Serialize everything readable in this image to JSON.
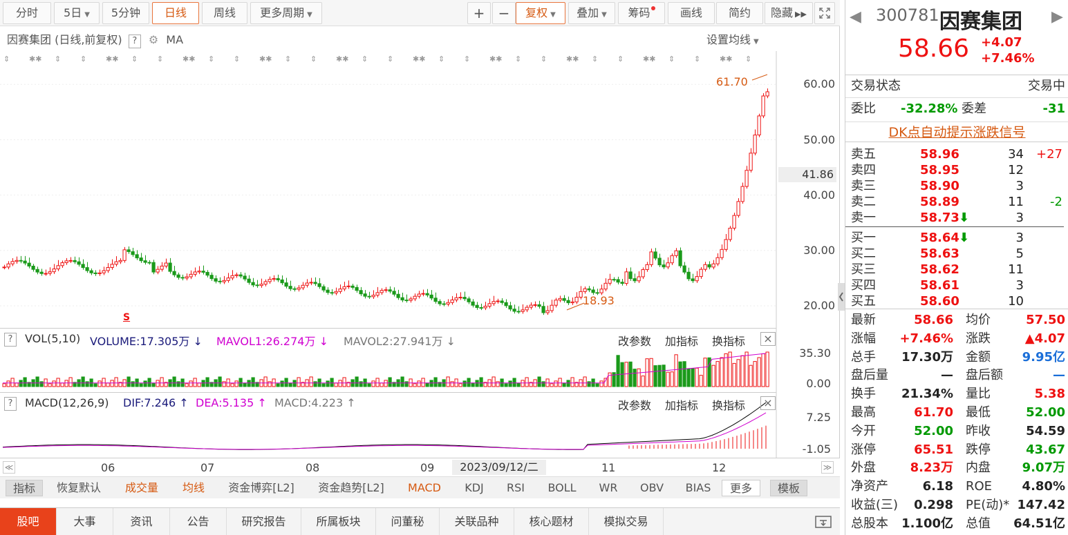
{
  "toolbar": {
    "periods": [
      "分时",
      "5日",
      "5分钟",
      "日线",
      "周线",
      "更多周期"
    ],
    "active_period": "日线",
    "plus": "+",
    "minus": "−",
    "fuquan": "复权",
    "diejia": "叠加",
    "choumа": "筹码",
    "huaxian": "画线",
    "jianyue": "简约",
    "yincang": "隐藏"
  },
  "chart": {
    "title": "因赛集团 (日线,前复权)",
    "q": "?",
    "ma": "MA",
    "set_ma": "设置均线",
    "high_label": "61.70",
    "low_label": "18.93",
    "cursor_price": "41.86",
    "y_ticks": [
      "60.00",
      "50.00",
      "40.00",
      "30.00",
      "20.00"
    ],
    "marker_s": "S"
  },
  "vol": {
    "q": "?",
    "name": "VOL(5,10)",
    "volume": "VOLUME:17.305万",
    "mavol1": "MAVOL1:26.274万",
    "mavol2": "MAVOL2:27.941万",
    "btn1": "改参数",
    "btn2": "加指标",
    "btn3": "换指标",
    "y_ticks": [
      "35.30",
      "0.00"
    ],
    "close": "×"
  },
  "macd": {
    "q": "?",
    "name": "MACD(12,26,9)",
    "dif": "DIF:7.246",
    "dea": "DEA:5.135",
    "macd": "MACD:4.223",
    "btn1": "改参数",
    "btn2": "加指标",
    "btn3": "换指标",
    "y_ticks": [
      "7.25",
      "-1.05"
    ],
    "close": "×"
  },
  "xaxis": {
    "months": [
      "06",
      "07",
      "08",
      "09",
      "11",
      "12"
    ],
    "cursor_date": "2023/09/12/二"
  },
  "ind_tabs": [
    "指标",
    "恢复默认",
    "成交量",
    "均线",
    "资金博弈[L2]",
    "资金趋势[L2]",
    "MACD",
    "KDJ",
    "RSI",
    "BOLL",
    "WR",
    "OBV",
    "BIAS",
    "更多",
    "模板"
  ],
  "bottom_tabs": [
    "股吧",
    "大事",
    "资讯",
    "公告",
    "研究报告",
    "所属板块",
    "问董秘",
    "关联品种",
    "核心题材",
    "模拟交易"
  ],
  "stock": {
    "code": "300781",
    "name": "因赛集团",
    "price": "58.66",
    "change": "+4.07",
    "pct": "+7.46%",
    "status_label": "交易状态",
    "status": "交易中",
    "weibi_label": "委比",
    "weibi": "-32.28%",
    "weicha_label": "委差",
    "weicha": "-31",
    "dk_banner": "DK点自动提示涨跌信号"
  },
  "orderbook": [
    {
      "label": "卖五",
      "price": "58.96",
      "vol": "34",
      "chg": "+27",
      "arrow": ""
    },
    {
      "label": "卖四",
      "price": "58.95",
      "vol": "12",
      "chg": "",
      "arrow": ""
    },
    {
      "label": "卖三",
      "price": "58.90",
      "vol": "3",
      "chg": "",
      "arrow": ""
    },
    {
      "label": "卖二",
      "price": "58.89",
      "vol": "11",
      "chg": "-2",
      "arrow": ""
    },
    {
      "label": "卖一",
      "price": "58.73",
      "vol": "3",
      "chg": "",
      "arrow": "⬇"
    },
    {
      "label": "买一",
      "price": "58.64",
      "vol": "3",
      "chg": "",
      "arrow": "⬇"
    },
    {
      "label": "买二",
      "price": "58.63",
      "vol": "5",
      "chg": "",
      "arrow": ""
    },
    {
      "label": "买三",
      "price": "58.62",
      "vol": "11",
      "chg": "",
      "arrow": ""
    },
    {
      "label": "买四",
      "price": "58.61",
      "vol": "3",
      "chg": "",
      "arrow": ""
    },
    {
      "label": "买五",
      "price": "58.60",
      "vol": "10",
      "chg": "",
      "arrow": ""
    }
  ],
  "stats": [
    {
      "l1": "最新",
      "v1": "58.66",
      "c1": "red",
      "l2": "均价",
      "v2": "57.50",
      "c2": "red"
    },
    {
      "l1": "涨幅",
      "v1": "+7.46%",
      "c1": "red",
      "l2": "涨跌",
      "v2": "▲4.07",
      "c2": "red"
    },
    {
      "l1": "总手",
      "v1": "17.30万",
      "c1": "",
      "l2": "金额",
      "v2": "9.95亿",
      "c2": "blue"
    },
    {
      "l1": "盘后量",
      "v1": "—",
      "c1": "",
      "l2": "盘后额",
      "v2": "—",
      "c2": "blue"
    },
    {
      "l1": "换手",
      "v1": "21.34%",
      "c1": "",
      "l2": "量比",
      "v2": "5.38",
      "c2": "red"
    },
    {
      "l1": "最高",
      "v1": "61.70",
      "c1": "red",
      "l2": "最低",
      "v2": "52.00",
      "c2": "green"
    },
    {
      "l1": "今开",
      "v1": "52.00",
      "c1": "green",
      "l2": "昨收",
      "v2": "54.59",
      "c2": ""
    },
    {
      "l1": "涨停",
      "v1": "65.51",
      "c1": "red",
      "l2": "跌停",
      "v2": "43.67",
      "c2": "green"
    },
    {
      "l1": "外盘",
      "v1": "8.23万",
      "c1": "red",
      "l2": "内盘",
      "v2": "9.07万",
      "c2": "green"
    },
    {
      "l1": "净资产",
      "v1": "6.18",
      "c1": "",
      "l2": "ROE",
      "v2": "4.80%",
      "c2": ""
    },
    {
      "l1": "收益(三)",
      "v1": "0.298",
      "c1": "",
      "l2": "PE(动)*",
      "v2": "147.42",
      "c2": ""
    },
    {
      "l1": "总股本",
      "v1": "1.100亿",
      "c1": "",
      "l2": "总值",
      "v2": "64.51亿",
      "c2": ""
    }
  ],
  "colors": {
    "up": "#e11",
    "down": "#1a9a1a",
    "accent": "#d65a12",
    "dif": "#000",
    "dea": "#d000d0"
  }
}
